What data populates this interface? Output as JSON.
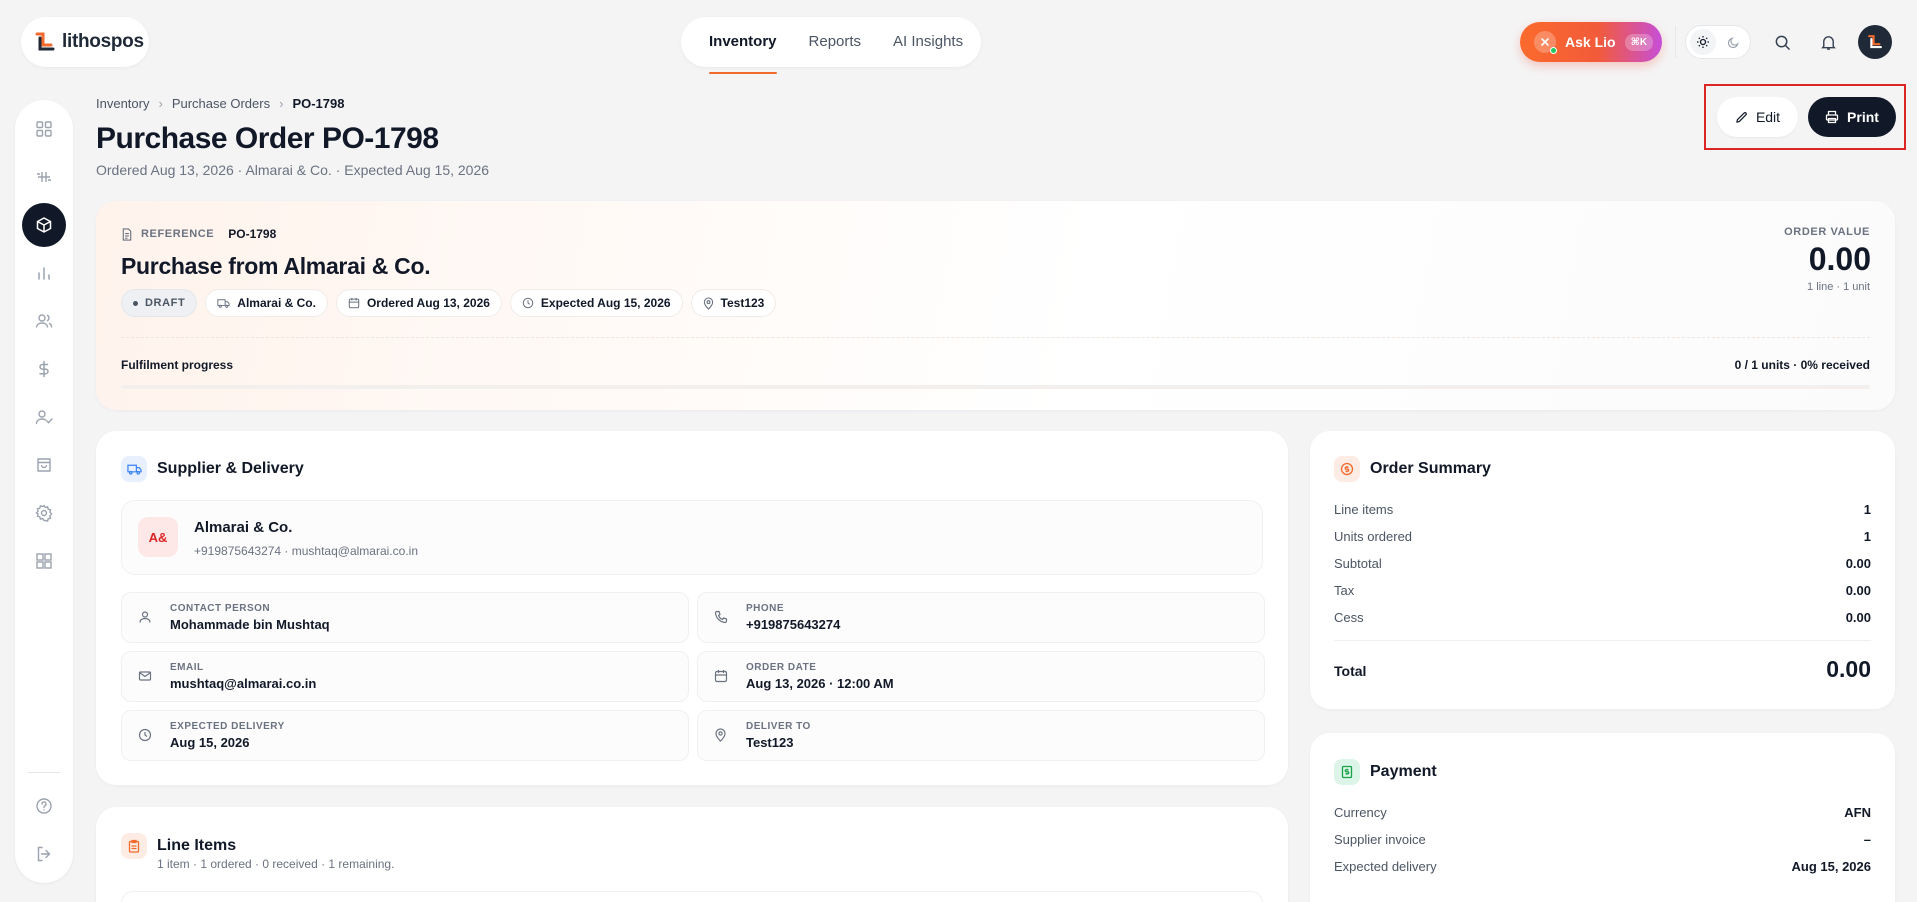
{
  "app": {
    "logo_text": "lithospos"
  },
  "nav": {
    "tabs": [
      {
        "label": "Inventory"
      },
      {
        "label": "Reports"
      },
      {
        "label": "AI Insights"
      }
    ]
  },
  "topbar": {
    "ask_label": "Ask Lio",
    "ask_shortcut": "⌘K"
  },
  "breadcrumb": {
    "items": [
      "Inventory",
      "Purchase Orders",
      "PO-1798"
    ]
  },
  "page": {
    "title": "Purchase Order PO-1798",
    "subtitle": "Ordered Aug 13, 2026 · Almarai & Co. · Expected Aug 15, 2026"
  },
  "actions": {
    "edit_label": "Edit",
    "print_label": "Print"
  },
  "hero": {
    "reference_label": "REFERENCE",
    "reference_value": "PO-1798",
    "title": "Purchase from Almarai & Co.",
    "chips": {
      "status": "DRAFT",
      "supplier": "Almarai & Co.",
      "ordered": "Ordered Aug 13, 2026",
      "expected": "Expected Aug 15, 2026",
      "location": "Test123"
    },
    "order_value_label": "ORDER VALUE",
    "order_value": "0.00",
    "order_value_sub": "1 line · 1 unit",
    "fulfilment_label": "Fulfilment progress",
    "fulfilment_value": "0 / 1 units · 0% received",
    "fulfilment_fraction": 0
  },
  "supplier_card": {
    "title": "Supplier & Delivery",
    "avatar_initials": "A&",
    "name": "Almarai & Co.",
    "contact": "+919875643274 · mushtaq@almarai.co.in",
    "fields": {
      "contact_person": {
        "label": "CONTACT PERSON",
        "value": "Mohammade bin Mushtaq"
      },
      "phone": {
        "label": "PHONE",
        "value": "+919875643274"
      },
      "email": {
        "label": "EMAIL",
        "value": "mushtaq@almarai.co.in"
      },
      "order_date": {
        "label": "ORDER DATE",
        "value": "Aug 13, 2026 · 12:00 AM"
      },
      "expected_delivery": {
        "label": "EXPECTED DELIVERY",
        "value": "Aug 15, 2026"
      },
      "deliver_to": {
        "label": "DELIVER TO",
        "value": "Test123"
      }
    }
  },
  "line_items": {
    "title": "Line Items",
    "subtitle": "1 item · 1 ordered · 0 received · 1 remaining."
  },
  "order_summary": {
    "title": "Order Summary",
    "rows": [
      {
        "label": "Line items",
        "value": "1"
      },
      {
        "label": "Units ordered",
        "value": "1"
      },
      {
        "label": "Subtotal",
        "value": "0.00"
      },
      {
        "label": "Tax",
        "value": "0.00"
      },
      {
        "label": "Cess",
        "value": "0.00"
      }
    ],
    "total_label": "Total",
    "total_value": "0.00"
  },
  "payment": {
    "title": "Payment",
    "rows": [
      {
        "label": "Currency",
        "value": "AFN"
      },
      {
        "label": "Supplier invoice",
        "value": "–"
      },
      {
        "label": "Expected delivery",
        "value": "Aug 15, 2026"
      }
    ]
  },
  "colors": {
    "accent": "#f26a2e",
    "dark": "#111827",
    "highlight_box": "#dc2626"
  }
}
